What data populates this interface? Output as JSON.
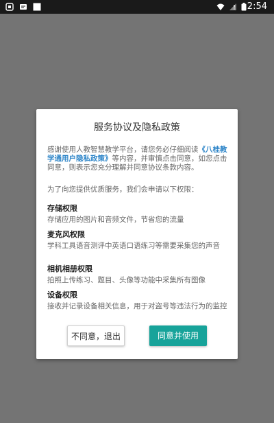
{
  "status_bar": {
    "time": "2:54",
    "icons": [
      "app-notification-icon",
      "message-icon",
      "white-square-icon",
      "wifi-icon",
      "no-sim-icon",
      "battery-icon"
    ]
  },
  "dialog": {
    "title": "服务协议及隐私政策",
    "intro_before": "感谢使用人教智慧教学平台，请您务必仔细阅读",
    "intro_link": "《八桂教学通用户隐私政策》",
    "intro_after": "等内容，并审慎点击同意，如您点击同意，则表示您充分理解并同意协议条款内容。",
    "permission_notice": "为了向您提供优质服务，我们会申请以下权限：",
    "permissions": [
      {
        "title": "存储权限",
        "desc": "存储应用的图片和音频文件，节省您的流量"
      },
      {
        "title": "麦克风权限",
        "desc": "学科工具语音测评中英语口语练习等需要采集您的声音"
      },
      {
        "title": "相机相册权限",
        "desc": "拍照上传练习、题目、头像等功能中采集所有图像"
      },
      {
        "title": "设备权限",
        "desc": "接收并记录设备相关信息，用于对盗号等违法行为的监控"
      }
    ],
    "decline_label": "不同意，退出",
    "accept_label": "同意并使用"
  },
  "colors": {
    "overlay": "#747474",
    "link": "#2f86c9",
    "accept_button": "#17a39a"
  }
}
